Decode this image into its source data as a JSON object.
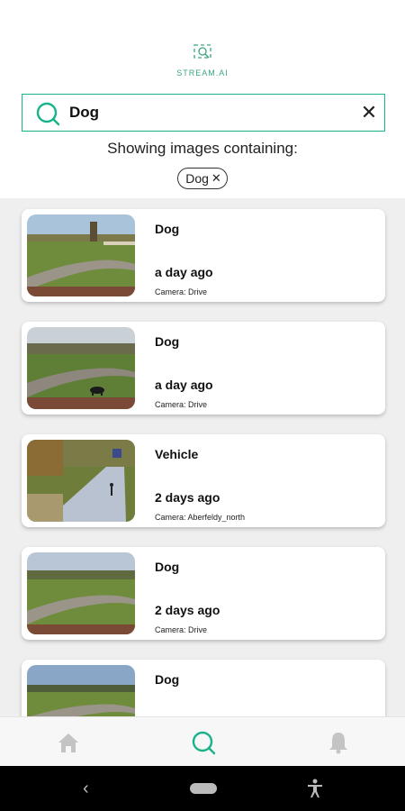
{
  "app": {
    "logo_text": "STREAM.AI"
  },
  "search": {
    "value": "Dog",
    "placeholder": ""
  },
  "filter": {
    "showing_text": "Showing images containing:",
    "chip_label": "Dog"
  },
  "results": [
    {
      "label": "Dog",
      "time": "a day ago",
      "camera": "Camera: Drive",
      "scene": "road"
    },
    {
      "label": "Dog",
      "time": "a day ago",
      "camera": "Camera: Drive",
      "scene": "road-dog"
    },
    {
      "label": "Vehicle",
      "time": "2 days ago",
      "camera": "Camera: Aberfeldy_north",
      "scene": "lane"
    },
    {
      "label": "Dog",
      "time": "2 days ago",
      "camera": "Camera: Drive",
      "scene": "road"
    },
    {
      "label": "Dog",
      "time": "",
      "camera": "",
      "scene": "road"
    }
  ],
  "nav": {
    "items": [
      "home-icon",
      "search-icon",
      "bell-icon"
    ],
    "active": "search-icon"
  },
  "colors": {
    "accent": "#19b28a",
    "list_bg": "#efefef",
    "inactive_icon": "#c4c4c4"
  }
}
